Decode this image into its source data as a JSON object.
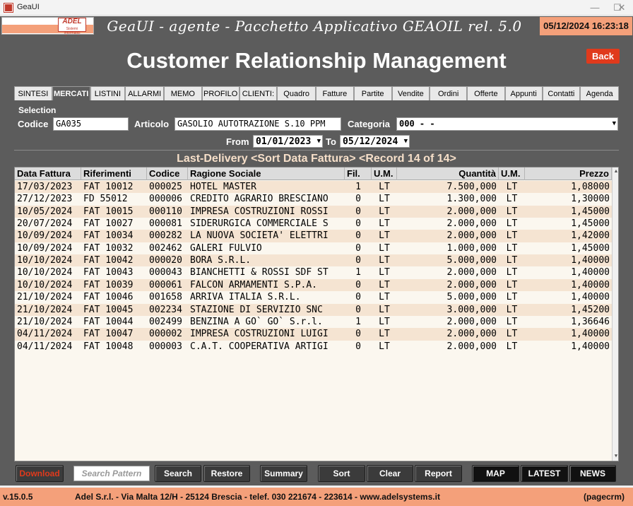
{
  "window": {
    "title": "GeaUI"
  },
  "header": {
    "logo_text": "ADEL",
    "logo_subtext": "Sistemi Informatici Personali",
    "title": "GeaUI - agente - Pacchetto Applicativo GEAOIL rel. 5.0",
    "datetime": "05/12/2024 16:23:18"
  },
  "main": {
    "page_title": "Customer Relationship Management",
    "back_label": "Back"
  },
  "tabs": [
    {
      "label": "SINTESI",
      "active": false
    },
    {
      "label": "MERCATI",
      "active": true
    },
    {
      "label": "LISTINI",
      "active": false
    },
    {
      "label": "ALLARMI",
      "active": false
    },
    {
      "label": "MEMO",
      "active": false
    },
    {
      "label": "PROFILO",
      "active": false
    },
    {
      "label": "CLIENTI:",
      "active": false
    },
    {
      "label": "Quadro",
      "active": false
    },
    {
      "label": "Fatture",
      "active": false
    },
    {
      "label": "Partite",
      "active": false
    },
    {
      "label": "Vendite",
      "active": false
    },
    {
      "label": "Ordini",
      "active": false
    },
    {
      "label": "Offerte",
      "active": false
    },
    {
      "label": "Appunti",
      "active": false
    },
    {
      "label": "Contatti",
      "active": false
    },
    {
      "label": "Agenda",
      "active": false
    }
  ],
  "selection": {
    "section_label": "Selection",
    "codice_label": "Codice",
    "codice_value": "GA035",
    "articolo_label": "Articolo",
    "articolo_value": "GASOLIO AUTOTRAZIONE S.10 PPM",
    "categoria_label": "Categoria",
    "categoria_value": "000 - -",
    "from_label": "From",
    "from_value": "01/01/2023",
    "to_label": "To",
    "to_value": "05/12/2024"
  },
  "banner": "Last-Delivery <Sort Data Fattura> <Record 14 of 14>",
  "table": {
    "columns": [
      "Data Fattura",
      "Riferimenti",
      "Codice",
      "Ragione Sociale",
      "Fil.",
      "U.M.",
      "Quantità",
      "U.M.",
      "Prezzo"
    ],
    "rows": [
      [
        "17/03/2023",
        "FAT 10012",
        "000025",
        "HOTEL MASTER",
        "1",
        "LT",
        "7.500,000",
        "LT",
        "1,08000"
      ],
      [
        "27/12/2023",
        "FD 55012",
        "000006",
        "CREDITO AGRARIO BRESCIANO",
        "0",
        "LT",
        "1.300,000",
        "LT",
        "1,30000"
      ],
      [
        "10/05/2024",
        "FAT 10015",
        "000110",
        "IMPRESA COSTRUZIONI ROSSI",
        "0",
        "LT",
        "2.000,000",
        "LT",
        "1,45000"
      ],
      [
        "20/07/2024",
        "FAT 10027",
        "000081",
        "SIDERURGICA COMMERCIALE S",
        "0",
        "LT",
        "2.000,000",
        "LT",
        "1,45000"
      ],
      [
        "10/09/2024",
        "FAT 10034",
        "000282",
        "LA NUOVA SOCIETA' ELETTRI",
        "0",
        "LT",
        "2.000,000",
        "LT",
        "1,42000"
      ],
      [
        "10/09/2024",
        "FAT 10032",
        "002462",
        "GALERI FULVIO",
        "0",
        "LT",
        "1.000,000",
        "LT",
        "1,45000"
      ],
      [
        "10/10/2024",
        "FAT 10042",
        "000020",
        "BORA S.R.L.",
        "0",
        "LT",
        "5.000,000",
        "LT",
        "1,40000"
      ],
      [
        "10/10/2024",
        "FAT 10043",
        "000043",
        "BIANCHETTI & ROSSI SDF ST",
        "1",
        "LT",
        "2.000,000",
        "LT",
        "1,40000"
      ],
      [
        "10/10/2024",
        "FAT 10039",
        "000061",
        "FALCON ARMAMENTI S.P.A.",
        "0",
        "LT",
        "2.000,000",
        "LT",
        "1,40000"
      ],
      [
        "21/10/2024",
        "FAT 10046",
        "001658",
        "ARRIVA ITALIA S.R.L.",
        "0",
        "LT",
        "5.000,000",
        "LT",
        "1,40000"
      ],
      [
        "21/10/2024",
        "FAT 10045",
        "002234",
        "STAZIONE DI SERVIZIO SNC",
        "0",
        "LT",
        "3.000,000",
        "LT",
        "1,45200"
      ],
      [
        "21/10/2024",
        "FAT 10044",
        "002499",
        "BENZINA A GO` GO` S.r.l.",
        "1",
        "LT",
        "2.000,000",
        "LT",
        "1,36646"
      ],
      [
        "04/11/2024",
        "FAT 10047",
        "000002",
        "IMPRESA COSTRUZIONI LUIGI",
        "0",
        "LT",
        "2.000,000",
        "LT",
        "1,40000"
      ],
      [
        "04/11/2024",
        "FAT 10048",
        "000003",
        "C.A.T. COOPERATIVA ARTIGI",
        "0",
        "LT",
        "2.000,000",
        "LT",
        "1,40000"
      ]
    ]
  },
  "buttons": {
    "download": "Download",
    "search_pattern": "Search Pattern",
    "search": "Search",
    "restore": "Restore",
    "summary": "Summary",
    "sort": "Sort",
    "clear": "Clear",
    "report": "Report",
    "map": "MAP",
    "latest": "LATEST",
    "news": "NEWS"
  },
  "footer": {
    "version": "v.15.0.5",
    "company": "Adel S.r.l. - Via Malta 12/H - 25124 Brescia - telef. 030 221674 - 223614 - www.adelsystems.it",
    "page_id": "(pagecrm)"
  },
  "colors": {
    "accent_salmon": "#f4a07a",
    "panel_gray": "#5c5c5c",
    "back_red": "#e03a1c",
    "row_alt": "#f5e4d2",
    "download_red": "#e03a1c"
  }
}
